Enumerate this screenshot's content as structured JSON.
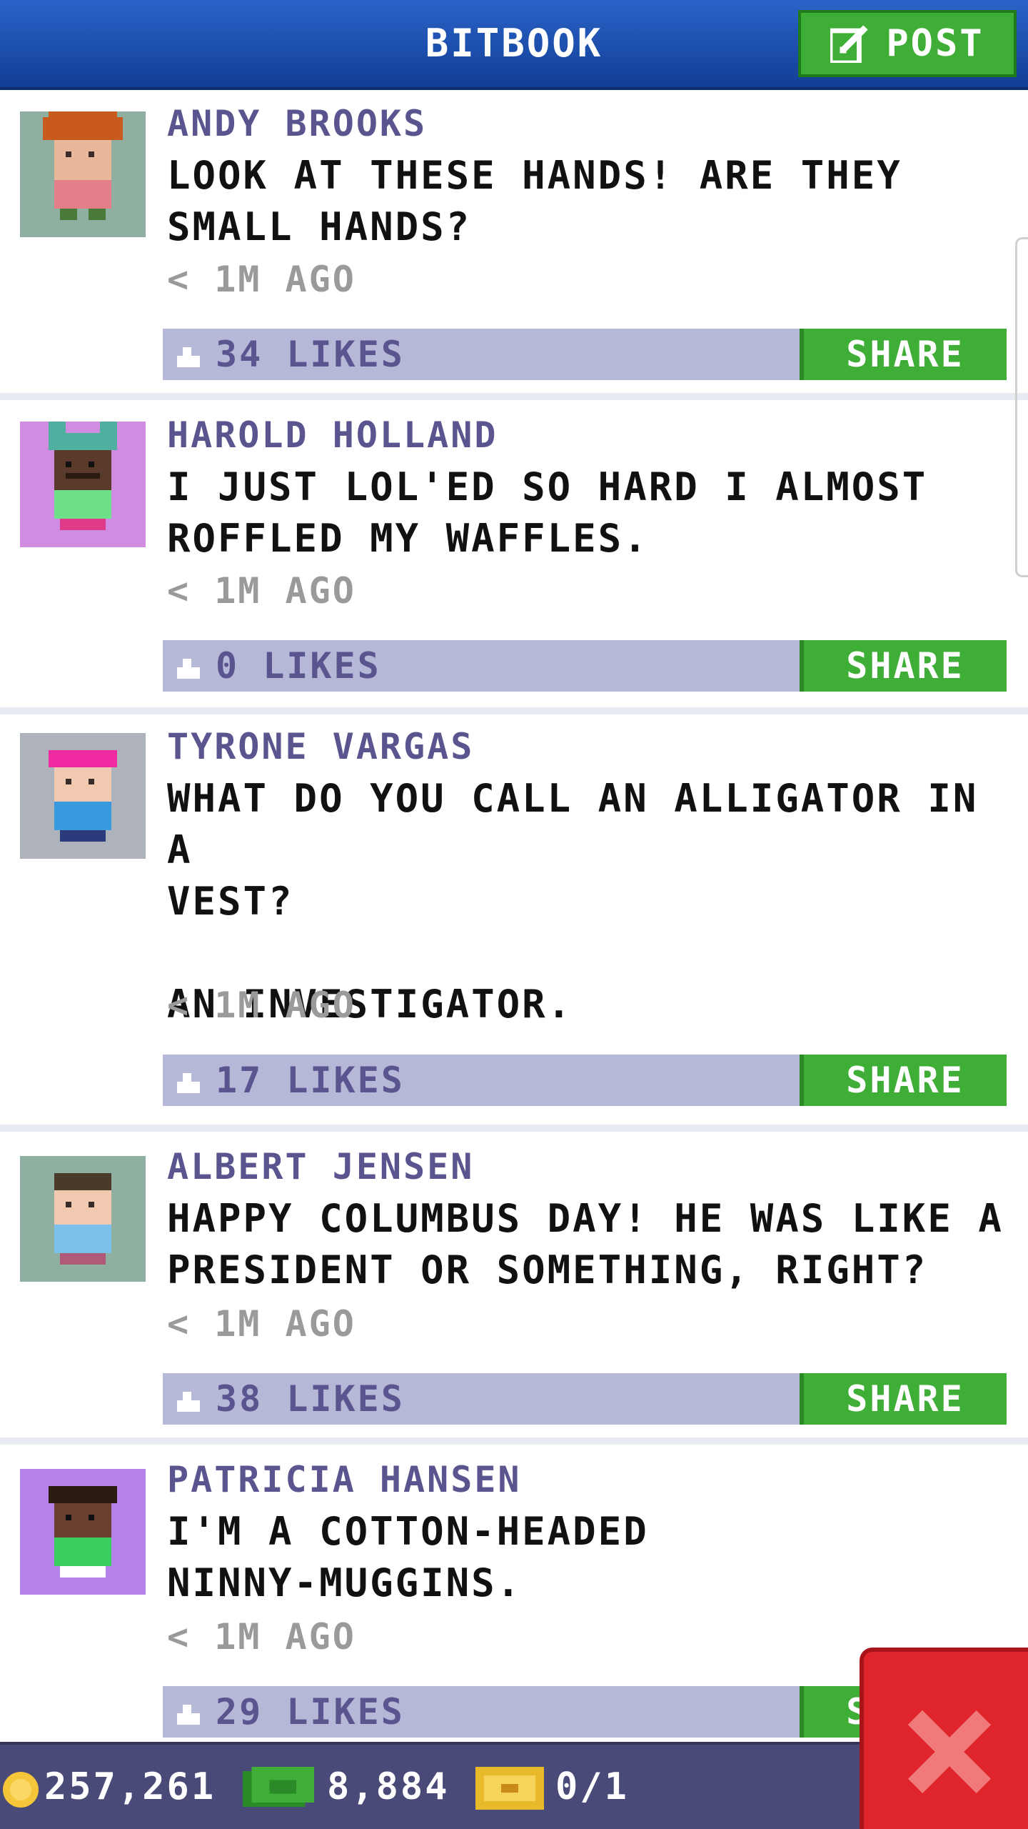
{
  "header": {
    "title": "BITBOOK",
    "post_label": "POST"
  },
  "posts": [
    {
      "author": "ANDY BROOKS",
      "text": "LOOK AT THESE HANDS! ARE THEY\nSMALL HANDS?",
      "time": "< 1M AGO",
      "likes": "34 LIKES",
      "share_label": "SHARE"
    },
    {
      "author": "HAROLD HOLLAND",
      "text": "I JUST LOL'ED SO HARD I ALMOST\nROFFLED MY WAFFLES.",
      "time": "< 1M AGO",
      "likes": "0 LIKES",
      "share_label": "SHARE"
    },
    {
      "author": "TYRONE VARGAS",
      "text": "WHAT DO YOU CALL AN ALLIGATOR IN A\nVEST?\n\nAN INVESTIGATOR.",
      "time": "< 1M AGO",
      "likes": "17 LIKES",
      "share_label": "SHARE"
    },
    {
      "author": "ALBERT JENSEN",
      "text": "HAPPY COLUMBUS DAY! HE WAS LIKE A\nPRESIDENT OR SOMETHING, RIGHT?",
      "time": "< 1M AGO",
      "likes": "38 LIKES",
      "share_label": "SHARE"
    },
    {
      "author": "PATRICIA HANSEN",
      "text": "I'M A COTTON-HEADED\nNINNY-MUGGINS.",
      "time": "< 1M AGO",
      "likes": "29 LIKES",
      "share_label": "SHARE"
    }
  ],
  "bottom_bar": {
    "coins": "257,261",
    "bux": "8,884",
    "tickets": "0/1"
  },
  "colors": {
    "header": "#1f55b8",
    "accent_green": "#3fae37",
    "like_bar": "#b6b8d8",
    "author": "#5a548f",
    "close": "#e0242b",
    "bottom_bar": "#4a4a78"
  },
  "icons": {
    "post": "edit-icon",
    "like": "thumbs-up-icon",
    "coins": "coin-icon",
    "bux": "bux-icon",
    "tickets": "ticket-icon",
    "close": "close-icon"
  }
}
